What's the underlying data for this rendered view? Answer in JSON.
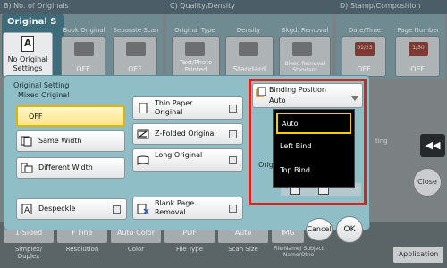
{
  "background": {
    "header": {
      "no_of_originals": "B) No. of Originals",
      "quality_density": "C) Quality/Density",
      "stamp_composition": "D) Stamp/Composition"
    },
    "original_title": "Original S",
    "no_original_settings": "No Original Settings",
    "top_labels": [
      "Book Original",
      "Separate Scan",
      "Original Type",
      "Density",
      "Bkgd. Removal",
      "Date/Time",
      "Page Number"
    ],
    "tiles": [
      {
        "label": "OFF"
      },
      {
        "label": "OFF"
      },
      {
        "label": "Text/Photo Printed"
      },
      {
        "label": "Standard"
      },
      {
        "label": "Bleed Removal Standard"
      },
      {
        "label": "OFF",
        "icon_text": "01/23"
      },
      {
        "label": "OFF",
        "icon_text": "1/50"
      }
    ],
    "bottom_tiles": [
      "1-Sided",
      "F Fine",
      "Auto Color",
      "PDF",
      "Auto",
      "IMG"
    ],
    "bottom_labels": [
      "Simplex/ Duplex",
      "Resolution",
      "Color",
      "File Type",
      "Scan Size",
      "File Name/ Subject Name/Othe"
    ],
    "setting_fragment": "ting",
    "side_arrow": "◀◀",
    "close_label": "Close",
    "application_label": "Application"
  },
  "dialog": {
    "title": "Original Setting",
    "mixed_original_label": "Mixed Original",
    "options": {
      "mixed_off": "OFF",
      "same_width": "Same Width",
      "different_width": "Different Width",
      "thin_paper": "Thin Paper Original",
      "z_folded": "Z-Folded Original",
      "long_original": "Long Original",
      "despeckle": "Despeckle",
      "blank_page_removal": "Blank Page Removal"
    },
    "binding": {
      "title": "Binding Position",
      "value": "Auto",
      "options": [
        "Auto",
        "Left Bind",
        "Top Bind"
      ],
      "selected_index": 0
    },
    "original_direction_label": "Orig",
    "cancel_label": "Cancel",
    "ok_label": "OK"
  },
  "colors": {
    "dialog_bg": "#8fbec6",
    "highlight": "#e02020",
    "selected_border": "#e0b400"
  }
}
